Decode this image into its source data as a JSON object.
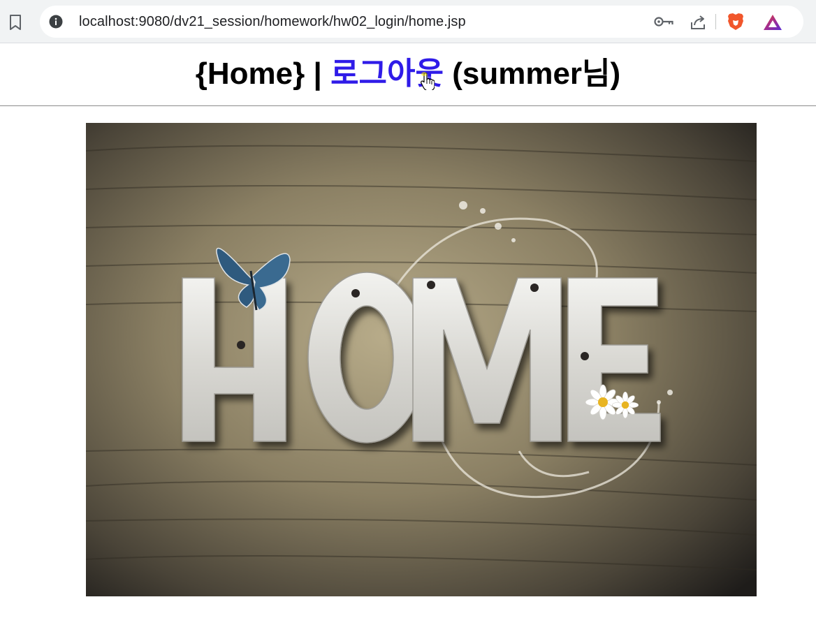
{
  "browser": {
    "url": "localhost:9080/dv21_session/homework/hw02_login/home.jsp",
    "icons": [
      "bookmark-icon",
      "site-info-icon",
      "password-key-icon",
      "share-icon",
      "brave-shields-icon",
      "brave-rewards-icon"
    ]
  },
  "header": {
    "home_label": "{Home}",
    "separator": "|",
    "logout_label": "로그아웃",
    "user_greeting": "(summer님)"
  },
  "image": {
    "alt": "HOME"
  },
  "colors": {
    "link": "#2f1be8",
    "chrome_bg": "#f1f3f4"
  }
}
